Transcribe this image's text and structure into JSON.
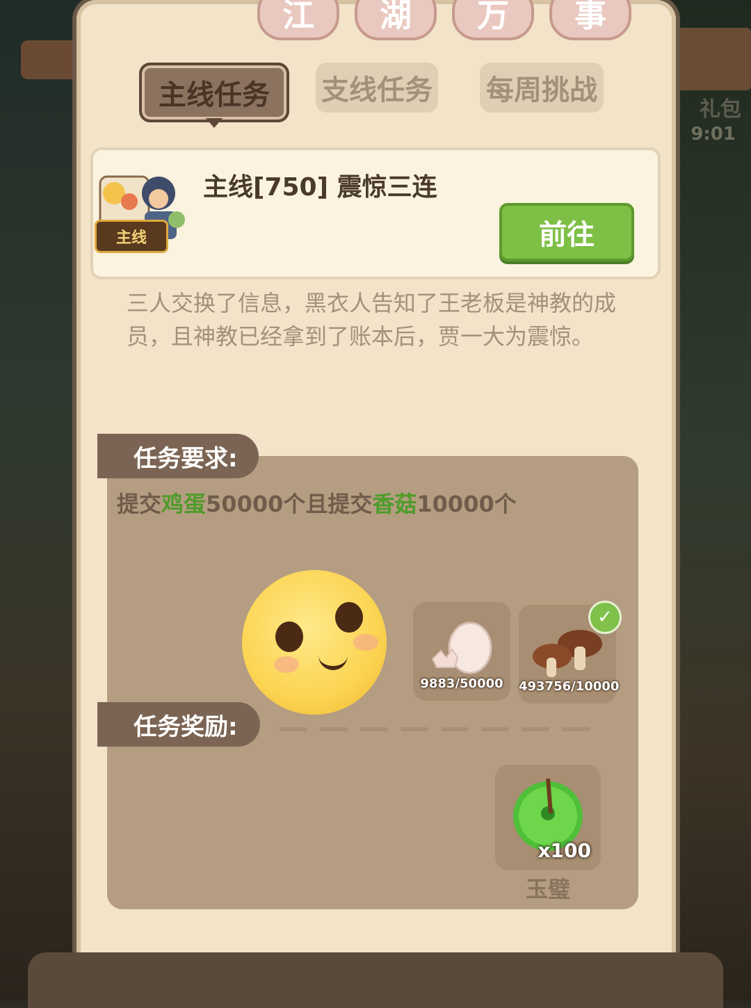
{
  "title": {
    "chars": [
      "江",
      "湖",
      "万",
      "事"
    ]
  },
  "tabs": [
    {
      "label": "主线任务",
      "active": true
    },
    {
      "label": "支线任务",
      "active": false
    },
    {
      "label": "每周挑战",
      "active": false
    }
  ],
  "quest": {
    "badge": "主线",
    "title": "主线[750] 震惊三连",
    "goto_label": "前往",
    "description": "三人交换了信息，黑衣人告知了王老板是神教的成员，且神教已经拿到了账本后，贾一大为震惊。"
  },
  "requirement": {
    "label": "任务要求:",
    "text_parts": [
      "提交",
      "鸡蛋",
      "50000个且提交",
      "香菇",
      "10000个"
    ],
    "items": [
      {
        "name": "egg-icon",
        "progress": "9883/50000",
        "completed": false
      },
      {
        "name": "mushroom-icon",
        "progress": "493756/10000",
        "completed": true
      }
    ]
  },
  "reward": {
    "label": "任务奖励:",
    "items": [
      {
        "name": "玉璧",
        "quantity": "x100",
        "icon": "jade-disc-icon"
      }
    ]
  },
  "side": {
    "gift_label": "礼包",
    "timer": "9:01"
  },
  "colors": {
    "accent_green": "#4f9b2a",
    "button_green": "#7ebf45",
    "panel": "#f2e3c9"
  }
}
